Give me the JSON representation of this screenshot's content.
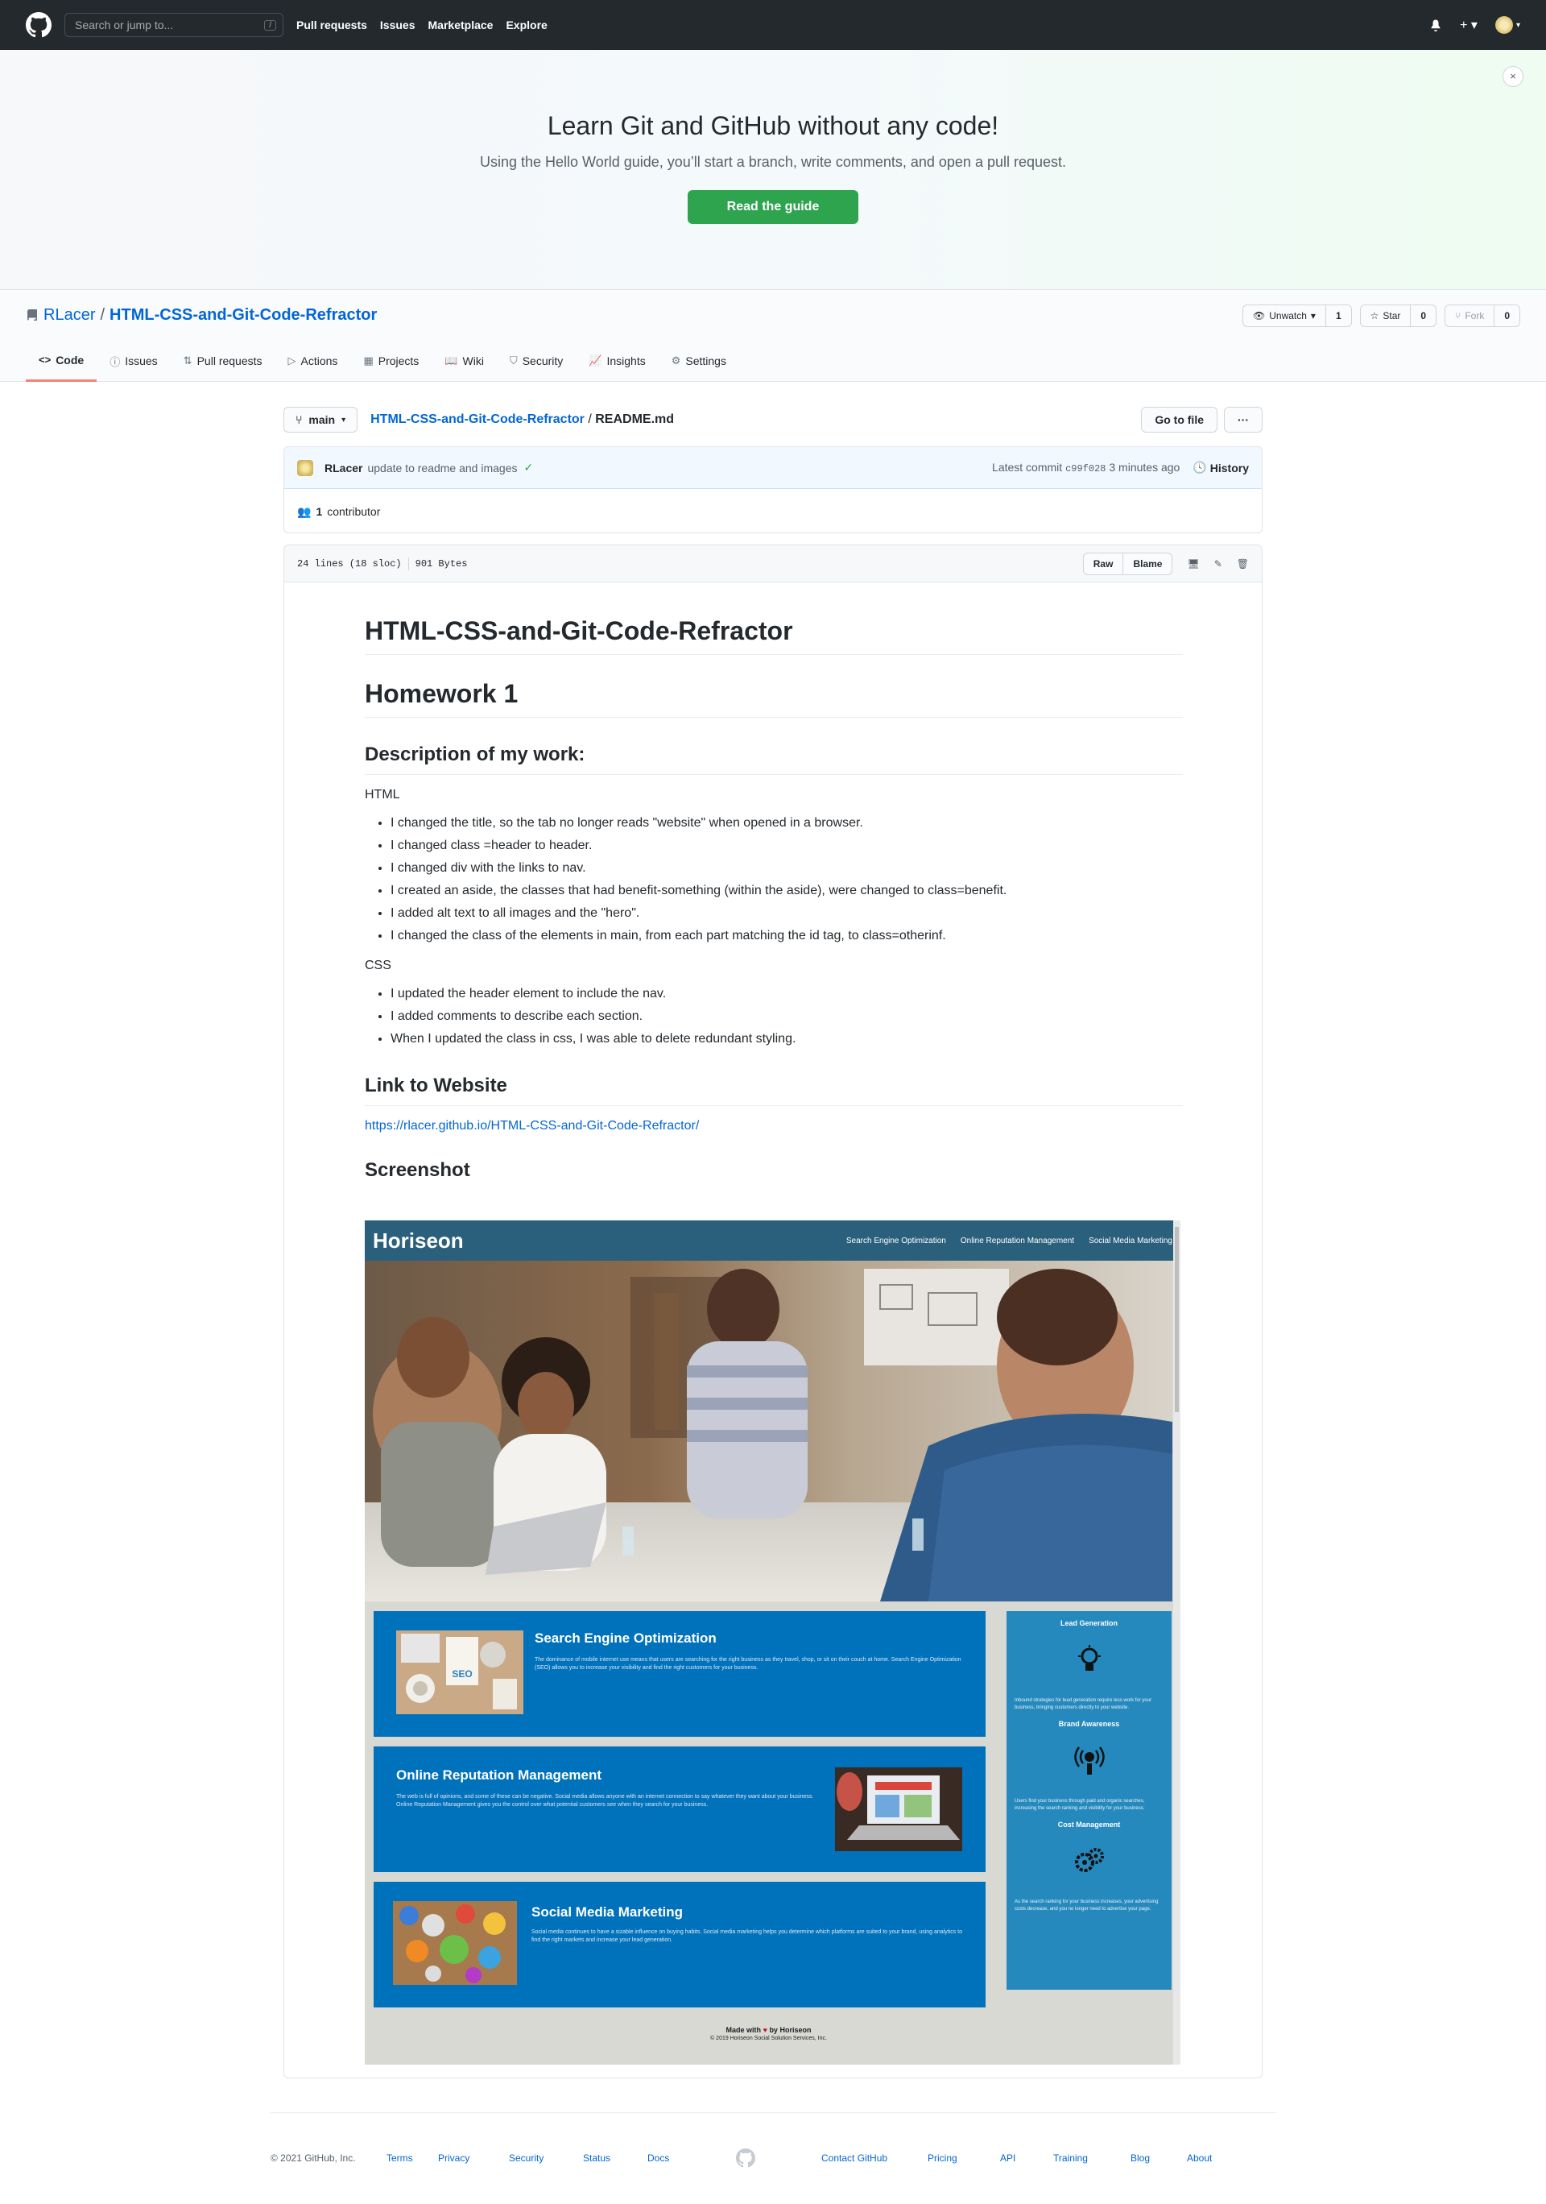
{
  "topnav": {
    "search_placeholder": "Search or jump to...",
    "slash_key": "/",
    "links": [
      "Pull requests",
      "Issues",
      "Marketplace",
      "Explore"
    ],
    "plus": "+ ▾",
    "avatar_caret": "▾"
  },
  "banner": {
    "title": "Learn Git and GitHub without any code!",
    "subtitle": "Using the Hello World guide, you’ll start a branch, write comments, and open a pull request.",
    "button": "Read the guide",
    "close": "×"
  },
  "repo": {
    "owner": "RLacer",
    "separator": "/",
    "name": "HTML-CSS-and-Git-Code-Refractor",
    "unwatch_label": "Unwatch",
    "unwatch_caret": "▾",
    "unwatch_count": "1",
    "star_label": "Star",
    "star_count": "0",
    "fork_label": "Fork",
    "fork_count": "0",
    "tabs": [
      {
        "label": "Code",
        "icon": "code-icon"
      },
      {
        "label": "Issues",
        "icon": "issue-icon"
      },
      {
        "label": "Pull requests",
        "icon": "pull-request-icon"
      },
      {
        "label": "Actions",
        "icon": "play-icon"
      },
      {
        "label": "Projects",
        "icon": "project-icon"
      },
      {
        "label": "Wiki",
        "icon": "book-icon"
      },
      {
        "label": "Security",
        "icon": "shield-icon"
      },
      {
        "label": "Insights",
        "icon": "graph-icon"
      },
      {
        "label": "Settings",
        "icon": "gear-icon"
      }
    ]
  },
  "filenav": {
    "branch": "main",
    "branch_caret": "▾",
    "repo_link": "HTML-CSS-and-Git-Code-Refractor",
    "separator": "/",
    "file": "README.md",
    "go_to_file": "Go to file",
    "more": "···"
  },
  "commit": {
    "author": "RLacer",
    "message": "update to readme and images",
    "check": "✓",
    "latest_label": "Latest commit",
    "sha": "c99f028",
    "time": "3 minutes ago",
    "history": "History",
    "contributors_count": "1",
    "contributors_label": "contributor"
  },
  "file": {
    "lines": "24 lines (18 sloc)",
    "size": "901 Bytes",
    "raw": "Raw",
    "blame": "Blame"
  },
  "readme": {
    "h1": "HTML-CSS-and-Git-Code-Refractor",
    "h1b": "Homework 1",
    "h2_desc": "Description of my work:",
    "html_label": "HTML",
    "html_items": [
      "I changed the title, so the tab no longer reads \"website\" when opened in a browser.",
      "I changed class =header to header.",
      "I changed div with the links to nav.",
      "I created an aside, the classes that had benefit-something (within the aside), were changed to class=benefit.",
      "I added alt text to all images and the \"hero\".",
      "I changed the class of the elements in main, from each part matching the id tag, to class=otherinf."
    ],
    "css_label": "CSS",
    "css_items": [
      "I updated the header element to include the nav.",
      "I added comments to describe each section.",
      "When I updated the class in css, I was able to delete redundant styling."
    ],
    "h2_link": "Link to Website",
    "link": "https://rlacer.github.io/HTML-CSS-and-Git-Code-Refractor/",
    "h2_shot": "Screenshot"
  },
  "screenshot": {
    "logo": "Horiseon",
    "nav": [
      "Search Engine Optimization",
      "Online Reputation Management",
      "Social Media Marketing"
    ],
    "cards": [
      {
        "title": "Search Engine Optimization",
        "text": "The dominance of mobile internet use means that users are searching for the right business as they travel, shop, or sit on their couch at home. Search Engine Optimization (SEO) allows you to increase your visibility and find the right customers for your business."
      },
      {
        "title": "Online Reputation Management",
        "text": "The web is full of opinions, and some of these can be negative. Social media allows anyone with an internet connection to say whatever they want about your business. Online Reputation Management gives you the control over what potential customers see when they search for your business."
      },
      {
        "title": "Social Media Marketing",
        "text": "Social media continues to have a sizable influence on buying habits. Social media marketing helps you determine which platforms are suited to your brand, using analytics to find the right markets and increase your lead generation."
      }
    ],
    "seo_badge": "SEO",
    "aside": [
      {
        "title": "Lead Generation",
        "text": "Inbound strategies for lead generation require less work for your business, bringing customers directly to your website."
      },
      {
        "title": "Brand Awareness",
        "text": "Users find your business through paid and organic searches, increasing the search ranking and visibility for your business."
      },
      {
        "title": "Cost Management",
        "text": "As the search ranking for your business increases, your advertising costs decrease, and you no longer need to advertise your page."
      }
    ],
    "footer_made": "Made with",
    "footer_by": "by Horiseon",
    "footer_copy": "© 2019 Horiseon Social Solution Services, Inc."
  },
  "footer": {
    "copyright": "© 2021 GitHub, Inc.",
    "left_links": [
      "Terms",
      "Privacy",
      "Security",
      "Status",
      "Docs"
    ],
    "right_links": [
      "Contact GitHub",
      "Pricing",
      "API",
      "Training",
      "Blog",
      "About"
    ]
  }
}
